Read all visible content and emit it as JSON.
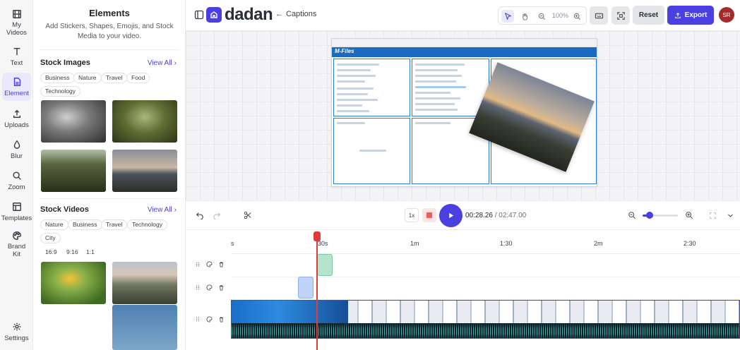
{
  "rail": {
    "items": [
      {
        "label": "My Videos"
      },
      {
        "label": "Text"
      },
      {
        "label": "Element"
      },
      {
        "label": "Uploads"
      },
      {
        "label": "Blur"
      },
      {
        "label": "Zoom"
      },
      {
        "label": "Templates"
      },
      {
        "label": "Brand Kit"
      }
    ],
    "settings": "Settings"
  },
  "panel": {
    "title": "Elements",
    "subtitle": "Add Stickers, Shapes, Emojis, and Stock Media to your video.",
    "stock_images": {
      "title": "Stock Images",
      "view_all": "View All",
      "chips": [
        "Business",
        "Nature",
        "Travel",
        "Food",
        "Technology"
      ]
    },
    "stock_videos": {
      "title": "Stock Videos",
      "view_all": "View All",
      "chips": [
        "Nature",
        "Business",
        "Travel",
        "Technology",
        "City"
      ],
      "ratios": [
        "16:9",
        "9:16",
        "1:1"
      ]
    }
  },
  "header": {
    "logo": "dadan",
    "back_label": "Captions",
    "zoom": "100%",
    "reset": "Reset",
    "export": "Export",
    "avatar": "SR"
  },
  "canvas": {
    "app_logo": "M-Files"
  },
  "controls": {
    "speed": "1x",
    "current_time": "00:28.26",
    "separator": "/",
    "total_time": "02:47.00",
    "zoom_level": 0.2
  },
  "timeline": {
    "ticks": [
      "s",
      "30s",
      "1m",
      "1:30",
      "2m",
      "2:30"
    ]
  },
  "colors": {
    "accent": "#4a3fe0",
    "playhead": "#e23b3b",
    "avatar": "#a52a2a"
  }
}
